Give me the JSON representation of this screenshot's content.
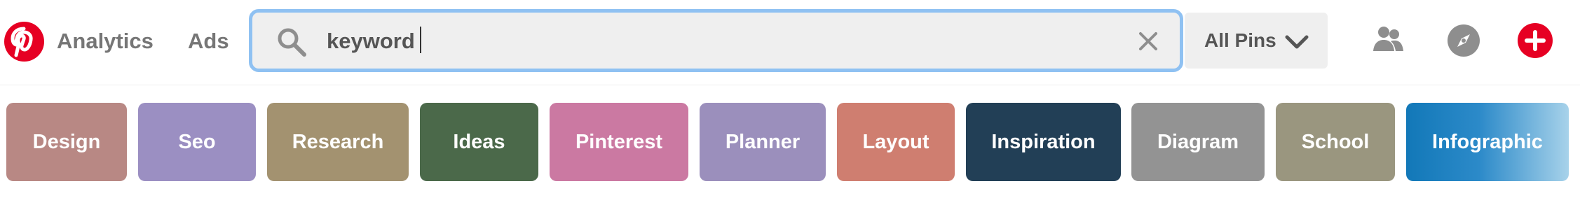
{
  "header": {
    "logo_icon": "pinterest-logo-icon",
    "nav": [
      {
        "label": "Analytics"
      },
      {
        "label": "Ads"
      }
    ],
    "search": {
      "value": "keyword",
      "placeholder": "",
      "icon": "search-icon",
      "clear_icon": "close-icon"
    },
    "filter": {
      "selected": "All Pins",
      "icon": "chevron-down-icon"
    },
    "actions": [
      {
        "icon": "people-icon"
      },
      {
        "icon": "compass-icon"
      },
      {
        "icon": "add-icon"
      }
    ]
  },
  "tags": [
    {
      "label": "Design",
      "color": "#b88884"
    },
    {
      "label": "Seo",
      "color": "#9b8fc2"
    },
    {
      "label": "Research",
      "color": "#a39270"
    },
    {
      "label": "Ideas",
      "color": "#4b694a"
    },
    {
      "label": "Pinterest",
      "color": "#cb79a2"
    },
    {
      "label": "Planner",
      "color": "#9b8fbc"
    },
    {
      "label": "Layout",
      "color": "#cf7e70"
    },
    {
      "label": "Inspiration",
      "color": "#223f56"
    },
    {
      "label": "Diagram",
      "color": "#939393"
    },
    {
      "label": "School",
      "color": "#9a967f"
    },
    {
      "label": "Infographic",
      "color": "#1278b8"
    }
  ],
  "colors": {
    "brand": "#e60023",
    "search_focus": "#8fc1f2",
    "surface": "#efefef",
    "nav_text": "#767676"
  }
}
